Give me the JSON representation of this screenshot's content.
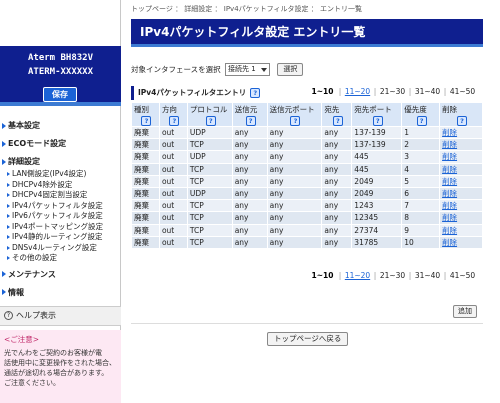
{
  "sidebar": {
    "model_line1": "Aterm  BH832V",
    "model_line2": "ATERM-XXXXXX",
    "save_label": "保存",
    "nav": [
      {
        "label": "基本設定",
        "level": 1
      },
      {
        "label": "ECOモード設定",
        "level": 1
      },
      {
        "label": "詳細設定",
        "level": 1
      },
      {
        "label": "LAN側設定(IPv4設定)",
        "level": 2
      },
      {
        "label": "DHCPv4除外設定",
        "level": 2
      },
      {
        "label": "DHCPv4固定割当設定",
        "level": 2
      },
      {
        "label": "IPv4パケットフィルタ設定",
        "level": 2
      },
      {
        "label": "IPv6パケットフィルタ設定",
        "level": 2
      },
      {
        "label": "IPv4ポートマッピング設定",
        "level": 2
      },
      {
        "label": "IPv4静的ルーティング設定",
        "level": 2
      },
      {
        "label": "DNSv4ルーティング設定",
        "level": 2
      },
      {
        "label": "その他の設定",
        "level": 2
      },
      {
        "label": "メンテナンス",
        "level": 1
      },
      {
        "label": "情報",
        "level": 1
      }
    ],
    "help_label": "ヘルプ表示",
    "notice_title": "<ご注意>",
    "notice_lines": [
      "光でんわをご契約のお客様が電",
      "話使用中に変更操作をされた場合、",
      "通話が途切れる場合があります。",
      "ご注意ください。"
    ]
  },
  "main": {
    "breadcrumb": "トップページ ： 詳細設定 ： IPv4パケットフィルタ設定 ： エントリ一覧",
    "title": "IPv4パケットフィルタ設定 エントリ一覧",
    "iface_label": "対象インタフェースを選択",
    "iface_value": "接続先 1",
    "select_button": "選択",
    "section_title": "IPv4パケットフィルタエントリ",
    "help_badge": "?",
    "pager": [
      "1~10",
      "11~20",
      "21~30",
      "31~40",
      "41~50"
    ],
    "pager_current_index": 0,
    "pager_link_index": 1,
    "columns": [
      "種別",
      "方向",
      "プロトコル",
      "送信元",
      "送信元ポート",
      "宛先",
      "宛先ポート",
      "優先度",
      "削除"
    ],
    "rows": [
      [
        "廃棄",
        "out",
        "UDP",
        "any",
        "any",
        "any",
        "137-139",
        "1",
        "削除"
      ],
      [
        "廃棄",
        "out",
        "TCP",
        "any",
        "any",
        "any",
        "137-139",
        "2",
        "削除"
      ],
      [
        "廃棄",
        "out",
        "UDP",
        "any",
        "any",
        "any",
        "445",
        "3",
        "削除"
      ],
      [
        "廃棄",
        "out",
        "TCP",
        "any",
        "any",
        "any",
        "445",
        "4",
        "削除"
      ],
      [
        "廃棄",
        "out",
        "TCP",
        "any",
        "any",
        "any",
        "2049",
        "5",
        "削除"
      ],
      [
        "廃棄",
        "out",
        "UDP",
        "any",
        "any",
        "any",
        "2049",
        "6",
        "削除"
      ],
      [
        "廃棄",
        "out",
        "TCP",
        "any",
        "any",
        "any",
        "1243",
        "7",
        "削除"
      ],
      [
        "廃棄",
        "out",
        "TCP",
        "any",
        "any",
        "any",
        "12345",
        "8",
        "削除"
      ],
      [
        "廃棄",
        "out",
        "TCP",
        "any",
        "any",
        "any",
        "27374",
        "9",
        "削除"
      ],
      [
        "廃棄",
        "out",
        "TCP",
        "any",
        "any",
        "any",
        "31785",
        "10",
        "削除"
      ]
    ],
    "add_button": "追加",
    "top_button": "トップページへ戻る"
  },
  "colors": {
    "header_navy": "#0f1f8f",
    "accent_blue": "#3c7bd3",
    "link_blue": "#1b63d6",
    "notice_pink": "#fde8f3"
  }
}
